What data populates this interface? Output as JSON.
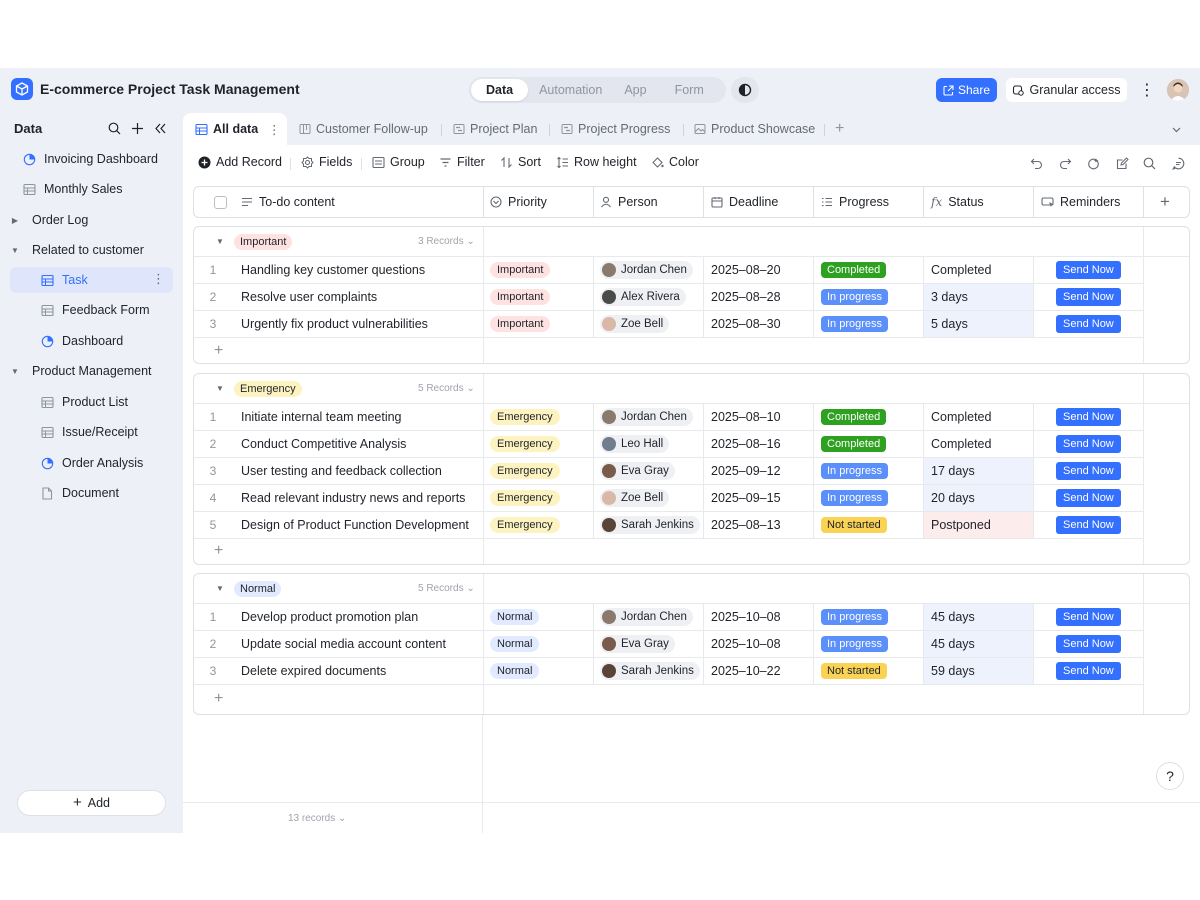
{
  "app": {
    "title": "E-commerce Project Task Management"
  },
  "mode_tabs": [
    "Data",
    "Automation",
    "App",
    "Form"
  ],
  "header": {
    "share_label": "Share",
    "access_label": "Granular access"
  },
  "sidebar": {
    "title": "Data",
    "add_label": "Add",
    "items": [
      {
        "label": "Invoicing Dashboard",
        "icon": "dashboard-icon"
      },
      {
        "label": "Monthly Sales",
        "icon": "table-icon"
      },
      {
        "label": "Order Log",
        "icon": "folder-caret-icon"
      },
      {
        "label": "Related to customer",
        "icon": "folder-caret-icon"
      },
      {
        "label": "Task",
        "icon": "table-icon"
      },
      {
        "label": "Feedback Form",
        "icon": "table-icon"
      },
      {
        "label": "Dashboard",
        "icon": "dashboard-icon"
      },
      {
        "label": "Product Management",
        "icon": "folder-caret-icon"
      },
      {
        "label": "Product List",
        "icon": "table-icon"
      },
      {
        "label": "Issue/Receipt",
        "icon": "table-icon"
      },
      {
        "label": "Order Analysis",
        "icon": "dashboard-icon"
      },
      {
        "label": "Document",
        "icon": "doc-icon"
      }
    ]
  },
  "view_tabs": [
    "All data",
    "Customer Follow-up",
    "Project Plan",
    "Project Progress",
    "Product Showcase"
  ],
  "toolbar": {
    "add_record": "Add Record",
    "fields": "Fields",
    "group": "Group",
    "filter": "Filter",
    "sort": "Sort",
    "row_height": "Row height",
    "color": "Color"
  },
  "columns": [
    "To-do content",
    "Priority",
    "Person",
    "Deadline",
    "Progress",
    "Status",
    "Reminders"
  ],
  "colors": {
    "accent": "#3370ff",
    "important_bg": "#fde2e1",
    "important_fg": "#d83931",
    "emergency_bg": "#fdf3c1",
    "emergency_fg": "#8f6a00",
    "normal_bg": "#e1eaff",
    "normal_fg": "#245bdb",
    "completed": "#2ea121",
    "in_progress": "#5b8ff9",
    "not_started": "#fad355"
  },
  "groups": [
    {
      "name": "Important",
      "count_label": "3 Records",
      "rows": [
        {
          "idx": "1",
          "todo": "Handling key customer questions",
          "priority": "Important",
          "person": "Jordan Chen",
          "deadline": "2025–08–20",
          "progress": "Completed",
          "status": "Completed",
          "reminder": "Send Now"
        },
        {
          "idx": "2",
          "todo": "Resolve user complaints",
          "priority": "Important",
          "person": "Alex Rivera",
          "deadline": "2025–08–28",
          "progress": "In progress",
          "status": "3 days",
          "reminder": "Send Now"
        },
        {
          "idx": "3",
          "todo": "Urgently fix product vulnerabilities",
          "priority": "Important",
          "person": "Zoe Bell",
          "deadline": "2025–08–30",
          "progress": "In progress",
          "status": "5 days",
          "reminder": "Send Now"
        }
      ]
    },
    {
      "name": "Emergency",
      "count_label": "5 Records",
      "rows": [
        {
          "idx": "1",
          "todo": "Initiate internal team meeting",
          "priority": "Emergency",
          "person": "Jordan Chen",
          "deadline": "2025–08–10",
          "progress": "Completed",
          "status": "Completed",
          "reminder": "Send Now"
        },
        {
          "idx": "2",
          "todo": "Conduct Competitive Analysis",
          "priority": "Emergency",
          "person": "Leo Hall",
          "deadline": "2025–08–16",
          "progress": "Completed",
          "status": "Completed",
          "reminder": "Send Now"
        },
        {
          "idx": "3",
          "todo": "User testing and feedback collection",
          "priority": "Emergency",
          "person": "Eva Gray",
          "deadline": "2025–09–12",
          "progress": "In progress",
          "status": "17 days",
          "reminder": "Send Now"
        },
        {
          "idx": "4",
          "todo": "Read relevant industry news and reports",
          "priority": "Emergency",
          "person": "Zoe Bell",
          "deadline": "2025–09–15",
          "progress": "In progress",
          "status": "20 days",
          "reminder": "Send Now"
        },
        {
          "idx": "5",
          "todo": "Design of Product Function Development",
          "priority": "Emergency",
          "person": "Sarah Jenkins",
          "deadline": "2025–08–13",
          "progress": "Not started",
          "status": "Postponed",
          "reminder": "Send Now"
        }
      ]
    },
    {
      "name": "Normal",
      "count_label": "5 Records",
      "rows": [
        {
          "idx": "1",
          "todo": "Develop product promotion plan",
          "priority": "Normal",
          "person": "Jordan Chen",
          "deadline": "2025–10–08",
          "progress": "In progress",
          "status": "45 days",
          "reminder": "Send Now"
        },
        {
          "idx": "2",
          "todo": "Update social media account content",
          "priority": "Normal",
          "person": "Eva Gray",
          "deadline": "2025–10–08",
          "progress": "In progress",
          "status": "45 days",
          "reminder": "Send Now"
        },
        {
          "idx": "3",
          "todo": "Delete expired documents",
          "priority": "Normal",
          "person": "Sarah Jenkins",
          "deadline": "2025–10–22",
          "progress": "Not started",
          "status": "59 days",
          "reminder": "Send Now"
        }
      ]
    }
  ],
  "footer": {
    "records_label": "13 records"
  },
  "help_label": "?"
}
